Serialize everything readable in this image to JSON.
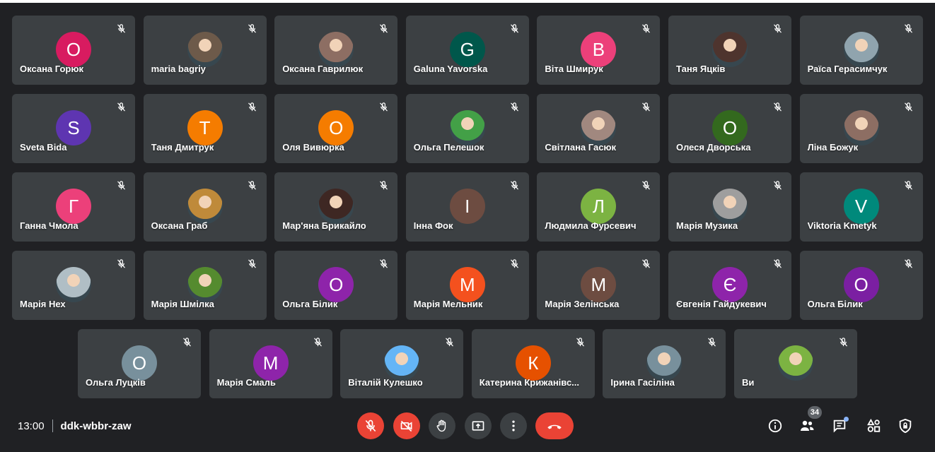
{
  "meeting": {
    "time": "13:00",
    "code": "ddk-wbbr-zaw",
    "participants_count": "34"
  },
  "colors": {
    "background": "#202124",
    "tile": "#3c4043",
    "danger": "#ea4335",
    "accent": "#8ab4f8"
  },
  "participants": [
    {
      "name": "Оксана Горюк",
      "initial": "О",
      "color": "#d81b60"
    },
    {
      "name": "maria bagriy",
      "photo": true,
      "color": "#6d5a4a"
    },
    {
      "name": "Оксана Гаврилюк",
      "photo": true,
      "color": "#8d6e63"
    },
    {
      "name": "Galuna Yavorska",
      "initial": "G",
      "color": "#00574b"
    },
    {
      "name": "Віта Шмирук",
      "initial": "В",
      "color": "#ec407a"
    },
    {
      "name": "Таня Яцків",
      "photo": true,
      "color": "#4e342e"
    },
    {
      "name": "Раїса Герасимчук",
      "photo": true,
      "color": "#90a4ae"
    },
    {
      "name": "Sveta Bida",
      "initial": "S",
      "color": "#5e35b1"
    },
    {
      "name": "Таня Дмитрук",
      "initial": "Т",
      "color": "#f57c00"
    },
    {
      "name": "Оля Вивюрка",
      "initial": "О",
      "color": "#f57c00"
    },
    {
      "name": "Ольга Пелешок",
      "photo": true,
      "color": "#43a047"
    },
    {
      "name": "Світлана Гасюк",
      "photo": true,
      "color": "#a1887f"
    },
    {
      "name": "Олеся Дворська",
      "initial": "О",
      "color": "#33691e"
    },
    {
      "name": "Ліна Божук",
      "photo": true,
      "color": "#8d6e63"
    },
    {
      "name": "Ганна Чмола",
      "initial": "Г",
      "color": "#ec407a"
    },
    {
      "name": "Оксана Граб",
      "photo": true,
      "color": "#bf8a3a"
    },
    {
      "name": "Мар'яна Брикайло",
      "photo": true,
      "color": "#3e2723"
    },
    {
      "name": "Інна Фок",
      "initial": "І",
      "color": "#6d4c41"
    },
    {
      "name": "Людмила Фурсевич",
      "initial": "Л",
      "color": "#7cb342"
    },
    {
      "name": "Марія Музика",
      "photo": true,
      "color": "#9e9e9e"
    },
    {
      "name": "Viktoria Kmetyk",
      "initial": "V",
      "color": "#00897b"
    },
    {
      "name": "Марія Нех",
      "photo": true,
      "color": "#b0bec5"
    },
    {
      "name": "Марія Шмілка",
      "photo": true,
      "color": "#558b2f"
    },
    {
      "name": "Ольга Білик",
      "initial": "О",
      "color": "#8e24aa"
    },
    {
      "name": "Марія Мельник",
      "initial": "М",
      "color": "#f4511e"
    },
    {
      "name": "Марія Зелінська",
      "initial": "М",
      "color": "#6d4c41"
    },
    {
      "name": "Євгенія Гайдукевич",
      "initial": "Є",
      "color": "#8e24aa"
    },
    {
      "name": "Ольга Білик",
      "initial": "О",
      "color": "#7b1fa2"
    },
    {
      "name": "Ольга Луцків",
      "initial": "О",
      "color": "#78909c"
    },
    {
      "name": "Марія Смаль",
      "initial": "М",
      "color": "#8e24aa"
    },
    {
      "name": "Віталій Кулешко",
      "photo": true,
      "color": "#64b5f6"
    },
    {
      "name": "Катерина Крижанівс...",
      "initial": "К",
      "color": "#e65100"
    },
    {
      "name": "Ірина Гасіліна",
      "photo": true,
      "color": "#78909c"
    },
    {
      "name": "Ви",
      "photo": true,
      "color": "#7cb342"
    }
  ],
  "controls": [
    {
      "icon": "microphone-off-icon"
    },
    {
      "icon": "camera-off-icon"
    },
    {
      "icon": "raise-hand-icon"
    },
    {
      "icon": "present-screen-icon"
    },
    {
      "icon": "more-options-icon"
    },
    {
      "icon": "leave-call-icon"
    }
  ],
  "right_icons": [
    {
      "icon": "meeting-info-icon"
    },
    {
      "icon": "people-icon"
    },
    {
      "icon": "chat-icon"
    },
    {
      "icon": "activities-icon"
    },
    {
      "icon": "host-controls-icon"
    }
  ]
}
